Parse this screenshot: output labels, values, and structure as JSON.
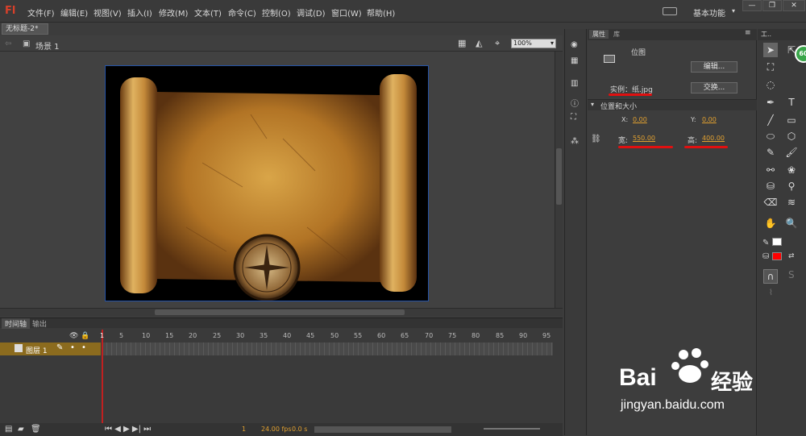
{
  "app": {
    "logo": "Fl"
  },
  "menubar": {
    "items": [
      "文件(F)",
      "编辑(E)",
      "视图(V)",
      "插入(I)",
      "修改(M)",
      "文本(T)",
      "命令(C)",
      "控制(O)",
      "调试(D)",
      "窗口(W)",
      "帮助(H)"
    ],
    "workspace": "基本功能",
    "window_buttons": [
      "—",
      "❐",
      "✕"
    ]
  },
  "document": {
    "tab": "无标题-2*",
    "scene": "场景 1",
    "zoom": "100%"
  },
  "timeline": {
    "tabs": [
      "时间轴",
      "输出"
    ],
    "frame_numbers": [
      "1",
      "5",
      "10",
      "15",
      "20",
      "25",
      "30",
      "35",
      "40",
      "45",
      "50",
      "55",
      "60",
      "65",
      "70",
      "75",
      "80",
      "85",
      "90",
      "95"
    ],
    "layer_name": "图层 1",
    "status": {
      "frame": "1",
      "fps": "24.00 fps",
      "time": "0.0 s"
    }
  },
  "properties": {
    "tabs": [
      "属性",
      "库"
    ],
    "object_type": "位图",
    "edit_button": "编辑...",
    "instance_label": "实例：纸.jpg",
    "swap_button": "交换...",
    "section_title": "位置和大小",
    "x_label": "X:",
    "x_value": "0.00",
    "y_label": "Y:",
    "y_value": "0.00",
    "w_label": "宽:",
    "w_value": "550.00",
    "h_label": "高:",
    "h_value": "400.00"
  },
  "tools": {
    "header": "工.."
  },
  "watermark": {
    "brand": "Bai",
    "brand2": "经验",
    "url": "jingyan.baidu.com",
    "badge": "60"
  },
  "colors": {
    "accent_red": "#e01010",
    "value_orange": "#e0a030",
    "stage_border": "#2553a8",
    "fill_color": "#ff0000",
    "stroke_color": "#ffffff"
  }
}
